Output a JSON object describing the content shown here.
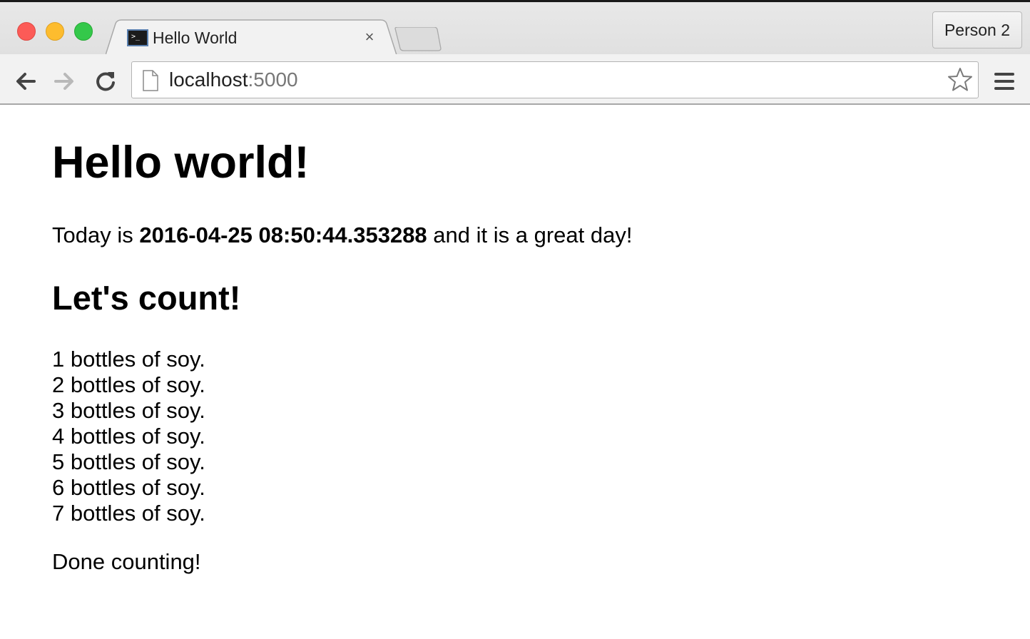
{
  "browser": {
    "tab": {
      "title": "Hello World",
      "close_glyph": "×"
    },
    "profile_button": "Person 2",
    "address": {
      "host": "localhost",
      "port": ":5000"
    },
    "icons": [
      "back-icon",
      "forward-icon",
      "reload-icon",
      "page-icon",
      "star-icon",
      "menu-icon",
      "terminal-favicon"
    ]
  },
  "page": {
    "heading": "Hello world!",
    "today": {
      "prefix": "Today is ",
      "datetime": "2016-04-25 08:50:44.353288",
      "suffix": " and it is a great day!"
    },
    "subheading": "Let's count!",
    "count_lines": [
      "1 bottles of soy.",
      "2 bottles of soy.",
      "3 bottles of soy.",
      "4 bottles of soy.",
      "5 bottles of soy.",
      "6 bottles of soy.",
      "7 bottles of soy."
    ],
    "done": "Done counting!"
  },
  "colors": {
    "close_light": "#fc5b57",
    "minimize_light": "#fdbc2e",
    "maximize_light": "#34c84a",
    "url_port": "#777777"
  }
}
